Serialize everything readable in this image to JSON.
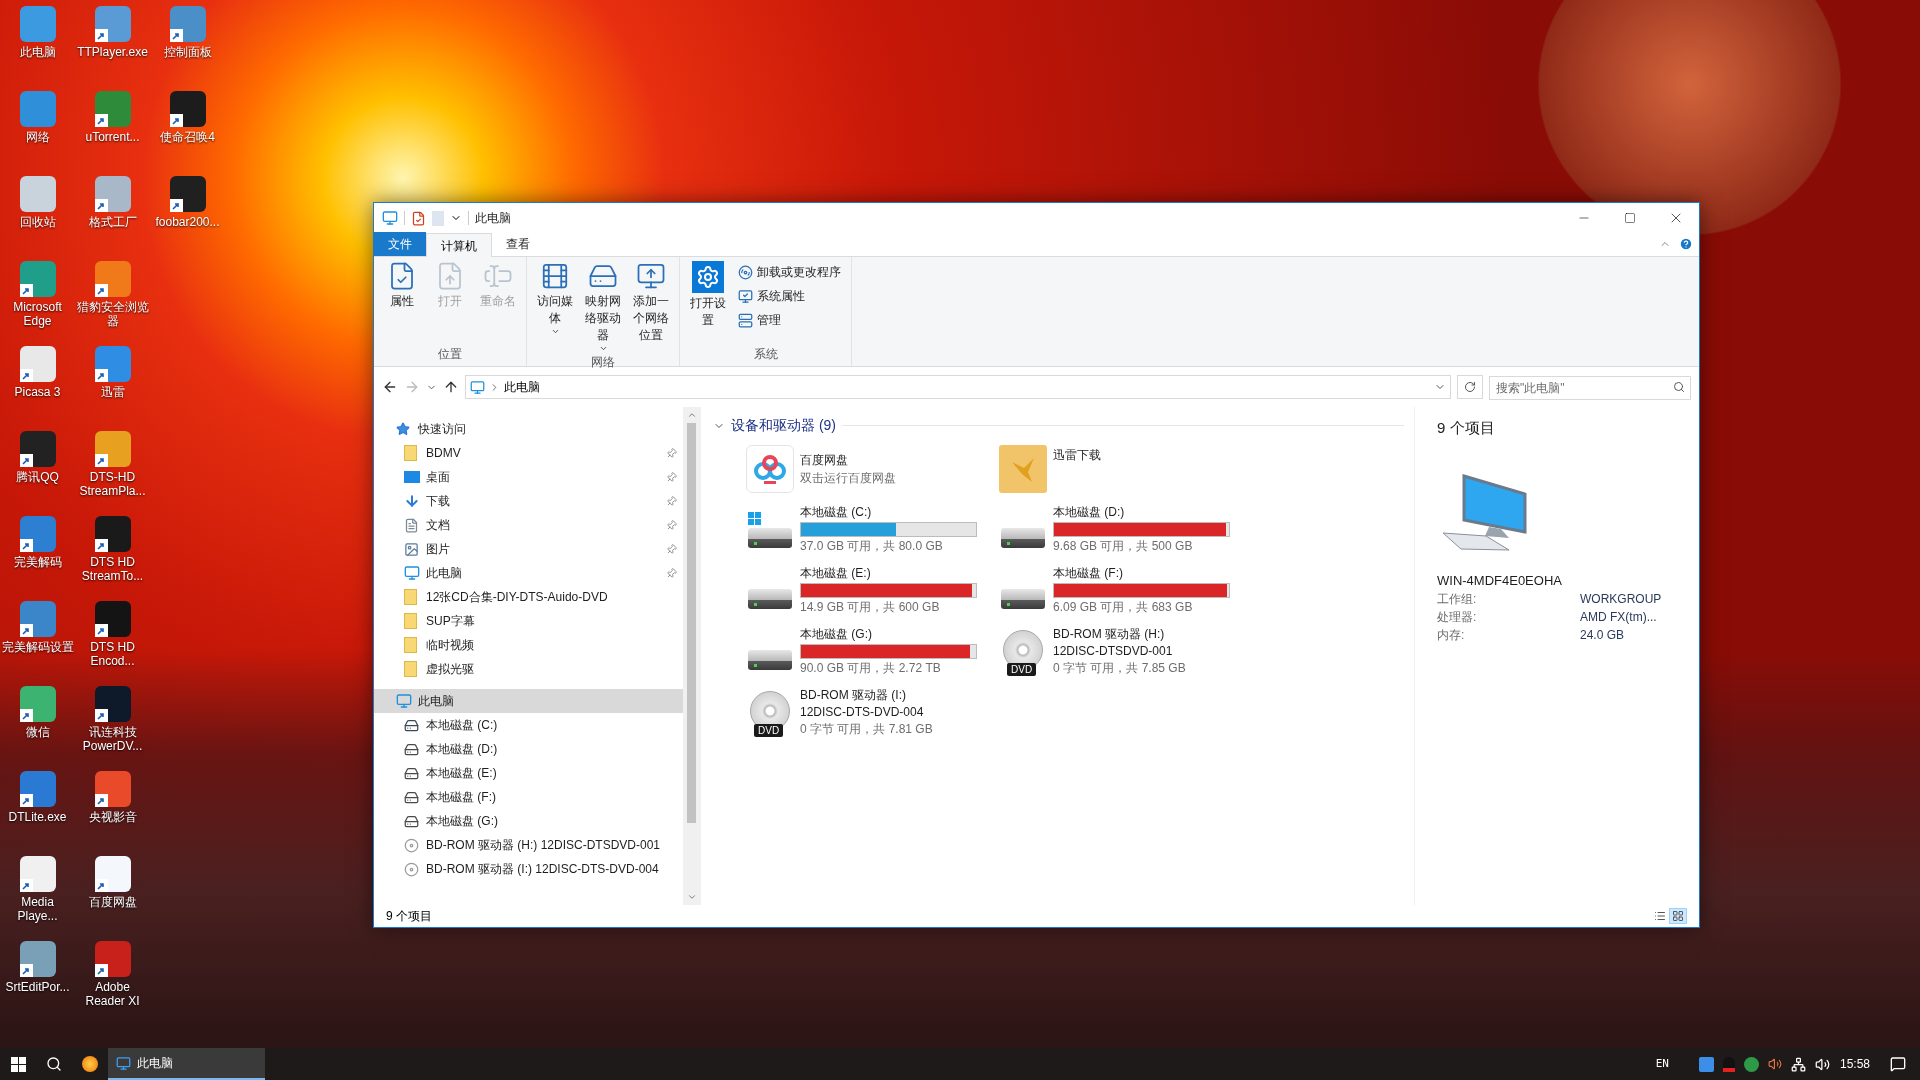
{
  "desktop": {
    "columns": [
      [
        {
          "label": "此电脑",
          "color": "#3c9be0",
          "shortcut": false
        },
        {
          "label": "网络",
          "color": "#2f8fd8",
          "shortcut": false
        },
        {
          "label": "回收站",
          "color": "#c9d3dc",
          "shortcut": false
        },
        {
          "label": "Microsoft Edge",
          "color": "#1f9e8a",
          "shortcut": true
        },
        {
          "label": "Picasa 3",
          "color": "#e8e8e8",
          "shortcut": true
        },
        {
          "label": "腾讯QQ",
          "color": "#222222",
          "shortcut": true
        },
        {
          "label": "完美解码",
          "color": "#2c7fd1",
          "shortcut": true
        },
        {
          "label": "完美解码设置",
          "color": "#3a86c8",
          "shortcut": true
        },
        {
          "label": "微信",
          "color": "#3cb371",
          "shortcut": true
        },
        {
          "label": "DTLite.exe",
          "color": "#2a7ad4",
          "shortcut": true
        },
        {
          "label": "Media Playe...",
          "color": "#f0f0f0",
          "shortcut": true
        },
        {
          "label": "SrtEditPor...",
          "color": "#7aa0b8",
          "shortcut": true
        }
      ],
      [
        {
          "label": "TTPlayer.exe",
          "color": "#5b9bd5",
          "shortcut": true
        },
        {
          "label": "uTorrent...",
          "color": "#2e8b3a",
          "shortcut": true
        },
        {
          "label": "格式工厂",
          "color": "#a9b8c8",
          "shortcut": true
        },
        {
          "label": "猎豹安全浏览器",
          "color": "#f07a1a",
          "shortcut": true
        },
        {
          "label": "迅雷",
          "color": "#2f8de4",
          "shortcut": true
        },
        {
          "label": "DTS-HD StreamPla...",
          "color": "#e8a020",
          "shortcut": true
        },
        {
          "label": "DTS HD StreamTo...",
          "color": "#1a1a1a",
          "shortcut": true
        },
        {
          "label": "DTS HD Encod...",
          "color": "#141414",
          "shortcut": true
        },
        {
          "label": "讯连科技 PowerDV...",
          "color": "#0e1a2a",
          "shortcut": true
        },
        {
          "label": "央视影音",
          "color": "#e84a2a",
          "shortcut": true
        },
        {
          "label": "百度网盘",
          "color": "#f4f8fc",
          "shortcut": true
        },
        {
          "label": "Adobe Reader XI",
          "color": "#c8201a",
          "shortcut": true
        }
      ],
      [
        {
          "label": "控制面板",
          "color": "#4a8fc8",
          "shortcut": true
        },
        {
          "label": "使命召唤4",
          "color": "#1c1c1c",
          "shortcut": true
        },
        {
          "label": "foobar200...",
          "color": "#202020",
          "shortcut": true
        }
      ]
    ]
  },
  "window": {
    "title": "此电脑",
    "tabs": [
      {
        "label": "文件",
        "kind": "file",
        "selected": false
      },
      {
        "label": "计算机",
        "kind": "tab",
        "selected": true
      },
      {
        "label": "查看",
        "kind": "tab",
        "selected": false
      }
    ],
    "ribbon": [
      {
        "label": "位置",
        "buttons": [
          {
            "label": "属性",
            "kind": "large",
            "disabled": false,
            "dropdown": false
          },
          {
            "label": "打开",
            "kind": "large",
            "disabled": true,
            "dropdown": false
          },
          {
            "label": "重命名",
            "kind": "large",
            "disabled": true,
            "dropdown": false
          }
        ]
      },
      {
        "label": "网络",
        "buttons": [
          {
            "label": "访问媒体",
            "kind": "large",
            "disabled": false,
            "dropdown": true
          },
          {
            "label": "映射网络驱动器",
            "kind": "large",
            "disabled": false,
            "dropdown": true
          },
          {
            "label": "添加一个网络位置",
            "kind": "large",
            "disabled": false,
            "dropdown": false
          }
        ]
      },
      {
        "label": "系统",
        "buttons": [
          {
            "label": "打开设置",
            "kind": "large",
            "disabled": false,
            "dropdown": false
          },
          {
            "label": "卸载或更改程序",
            "kind": "small",
            "disabled": false,
            "dropdown": false
          },
          {
            "label": "系统属性",
            "kind": "small",
            "disabled": false,
            "dropdown": false
          },
          {
            "label": "管理",
            "kind": "small",
            "disabled": false,
            "dropdown": false
          }
        ]
      }
    ],
    "address": {
      "path": "此电脑",
      "search_placeholder": "搜索\"此电脑\""
    },
    "nav": [
      {
        "label": "快速访问",
        "kind": "quick",
        "selected": false,
        "children": [
          {
            "label": "BDMV",
            "kind": "folder",
            "pinned": true,
            "selected": false
          },
          {
            "label": "桌面",
            "kind": "desktop",
            "pinned": true,
            "selected": false
          },
          {
            "label": "下载",
            "kind": "download",
            "pinned": true,
            "selected": false
          },
          {
            "label": "文档",
            "kind": "document",
            "pinned": true,
            "selected": false
          },
          {
            "label": "图片",
            "kind": "picture",
            "pinned": true,
            "selected": false
          },
          {
            "label": "此电脑",
            "kind": "computer",
            "pinned": true,
            "selected": false
          },
          {
            "label": "12张CD合集-DIY-DTS-Auido-DVD",
            "kind": "folder",
            "pinned": false,
            "selected": false
          },
          {
            "label": "SUP字幕",
            "kind": "folder",
            "pinned": false,
            "selected": false
          },
          {
            "label": "临时视频",
            "kind": "folder",
            "pinned": false,
            "selected": false
          },
          {
            "label": "虚拟光驱",
            "kind": "folder",
            "pinned": false,
            "selected": false
          }
        ]
      },
      {
        "label": "此电脑",
        "kind": "computer",
        "selected": true,
        "children": [
          {
            "label": "本地磁盘 (C:)",
            "kind": "disk-windows",
            "selected": false
          },
          {
            "label": "本地磁盘 (D:)",
            "kind": "disk",
            "selected": false
          },
          {
            "label": "本地磁盘 (E:)",
            "kind": "disk",
            "selected": false
          },
          {
            "label": "本地磁盘 (F:)",
            "kind": "disk",
            "selected": false
          },
          {
            "label": "本地磁盘 (G:)",
            "kind": "disk",
            "selected": false
          },
          {
            "label": "BD-ROM 驱动器 (H:) 12DISC-DTSDVD-001",
            "kind": "optical",
            "selected": false
          },
          {
            "label": "BD-ROM 驱动器 (I:) 12DISC-DTS-DVD-004",
            "kind": "optical",
            "selected": false
          }
        ]
      }
    ],
    "content": {
      "group": "设备和驱动器 (9)",
      "expanded": true,
      "tiles": [
        {
          "kind": "app",
          "name": "百度网盘",
          "subtitle": "双击运行百度网盘",
          "selected": false
        },
        {
          "kind": "folder",
          "name": "迅雷下载",
          "selected": false
        },
        {
          "kind": "disk",
          "name": "本地磁盘 (C:)",
          "windows": true,
          "level": 0.54,
          "free": "37.0 GB 可用，共 80.0 GB",
          "selected": false
        },
        {
          "kind": "disk",
          "name": "本地磁盘 (D:)",
          "windows": false,
          "level": 0.98,
          "free": "9.68 GB 可用，共 500 GB",
          "selected": false
        },
        {
          "kind": "disk",
          "name": "本地磁盘 (E:)",
          "windows": false,
          "level": 0.975,
          "free": "14.9 GB 可用，共 600 GB",
          "selected": false
        },
        {
          "kind": "disk",
          "name": "本地磁盘 (F:)",
          "windows": false,
          "level": 0.99,
          "free": "6.09 GB 可用，共 683 GB",
          "selected": false
        },
        {
          "kind": "disk",
          "name": "本地磁盘 (G:)",
          "windows": false,
          "level": 0.968,
          "free": "90.0 GB 可用，共 2.72 TB",
          "selected": false
        },
        {
          "kind": "optical",
          "name": "BD-ROM 驱动器 (H:)",
          "label": "12DISC-DTSDVD-001",
          "badge": "DVD",
          "free": "0 字节 可用，共 7.85 GB",
          "selected": false
        },
        {
          "kind": "optical",
          "name": "BD-ROM 驱动器 (I:)",
          "label": "12DISC-DTS-DVD-004",
          "badge": "DVD",
          "free": "0 字节 可用，共 7.81 GB",
          "selected": false
        }
      ]
    },
    "details": {
      "title": "9 个项目",
      "name": "WIN-4MDF4E0EOHA",
      "props": [
        {
          "label": "工作组:",
          "value": "WORKGROUP"
        },
        {
          "label": "处理器:",
          "value": "AMD FX(tm)..."
        },
        {
          "label": "内存:",
          "value": "24.0 GB"
        }
      ]
    },
    "status": {
      "text": "9 个项目",
      "views": [
        {
          "kind": "details",
          "selected": false
        },
        {
          "kind": "tiles",
          "selected": true
        }
      ]
    }
  },
  "taskbar": {
    "window_button": {
      "label": "此电脑",
      "selected": true
    },
    "language": "EN",
    "time": "15:58"
  }
}
